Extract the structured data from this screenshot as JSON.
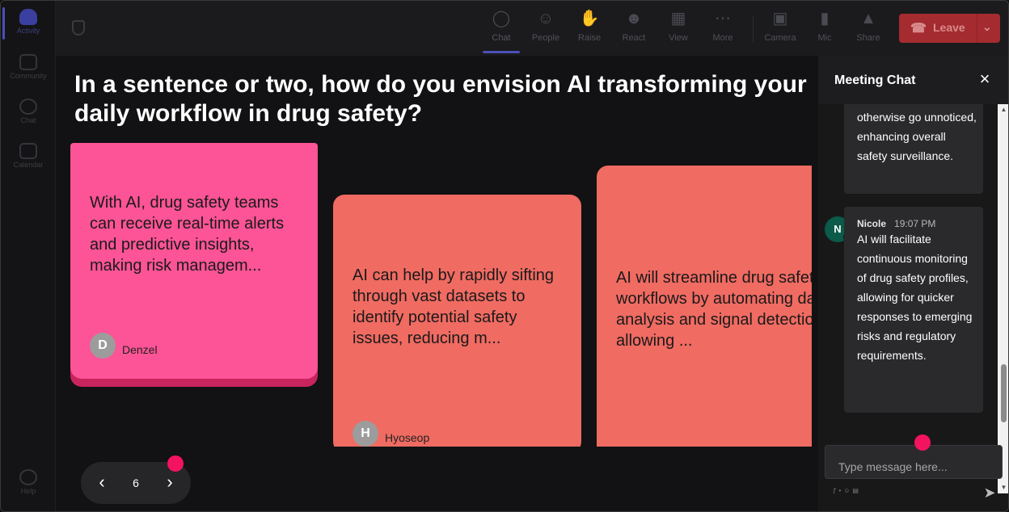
{
  "rail": {
    "items": [
      {
        "label": "Activity",
        "icon": "bell-icon"
      },
      {
        "label": "Community",
        "icon": "community-icon"
      },
      {
        "label": "Chat",
        "icon": "chat-icon"
      },
      {
        "label": "Calendar",
        "icon": "calendar-icon"
      },
      {
        "label": "Help",
        "icon": "help-icon"
      }
    ]
  },
  "toolbar": {
    "chat": "Chat",
    "people": "People",
    "raise": "Raise",
    "react": "React",
    "view": "View",
    "more": "More",
    "camera": "Camera",
    "mic": "Mic",
    "share": "Share",
    "leave": "Leave"
  },
  "question": "In a sentence or two, how do you envision AI transforming your daily workflow in drug safety?",
  "cards": [
    {
      "text": "With AI, drug safety teams can receive real-time alerts and predictive insights, making risk managem...",
      "initial": "D",
      "author": "Denzel",
      "color": "#fc5496"
    },
    {
      "text": "AI can help by rapidly sifting through vast datasets to identify potential safety issues, reducing m...",
      "initial": "H",
      "author": "Hyoseop",
      "color": "#f06b62"
    },
    {
      "text": "AI will streamline drug safety workflows by automating data analysis and signal detection, allowing ...",
      "color": "#f06b62"
    }
  ],
  "pager": {
    "page": "6"
  },
  "chat": {
    "title": "Meeting Chat",
    "messages": [
      {
        "text": "otherwise go unnoticed, enhancing overall safety surveillance."
      },
      {
        "initial": "N",
        "sender": "Nicole",
        "time": "19:07 PM",
        "text": "AI will facilitate continuous monitoring of drug safety profiles, allowing for quicker responses to emerging risks and regulatory requirements."
      }
    ],
    "placeholder": "Type message here..."
  },
  "colors": {
    "accent": "#4b50b8",
    "leave": "#a42b2f",
    "notification": "#f4135f"
  }
}
